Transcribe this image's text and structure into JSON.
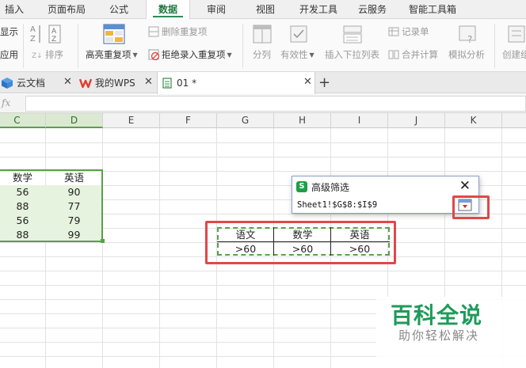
{
  "ribbon": {
    "tabs": [
      {
        "label": "插入",
        "active": false
      },
      {
        "label": "页面布局",
        "active": false
      },
      {
        "label": "公式",
        "active": false
      },
      {
        "label": "数据",
        "active": true
      },
      {
        "label": "审阅",
        "active": false
      },
      {
        "label": "视图",
        "active": false
      },
      {
        "label": "开发工具",
        "active": false
      },
      {
        "label": "云服务",
        "active": false
      },
      {
        "label": "智能工具箱",
        "active": false
      }
    ],
    "show_label": "显示",
    "apply_label": "应用",
    "sort_label": "排序",
    "highlight_dup_label": "高亮重复项",
    "delete_dup_label": "删除重复项",
    "reject_dup_label": "拒绝录入重复项",
    "split_label": "分列",
    "validity_label": "有效性",
    "insert_dropdown_label": "插入下拉列表",
    "record_label": "记录单",
    "merge_calc_label": "合并计算",
    "simulate_label": "模拟分析",
    "create_label": "创建组"
  },
  "doc_tabs": {
    "cloud_docs": "云文档",
    "my_wps": "我的WPS",
    "active_file": "01 *",
    "add": "+"
  },
  "formula_bar": {
    "fx": "fx",
    "value": ""
  },
  "sheet": {
    "columns": [
      "C",
      "D",
      "E",
      "F",
      "G",
      "H",
      "I",
      "J",
      "K"
    ],
    "data_table": {
      "headers": [
        "数学",
        "英语"
      ],
      "rows": [
        [
          "56",
          "90"
        ],
        [
          "88",
          "77"
        ],
        [
          "56",
          "79"
        ],
        [
          "88",
          "99"
        ]
      ]
    },
    "criteria": {
      "headers": [
        "语文",
        "数学",
        "英语"
      ],
      "values": [
        ">60",
        ">60",
        ">60"
      ]
    }
  },
  "dialog": {
    "title": "高级筛选",
    "logo": "S",
    "range_value": "Sheet1!$G$8:$I$9",
    "close": "✕"
  },
  "watermark": {
    "main": "百科全说",
    "sub": "助你轻松解决"
  },
  "colors": {
    "accent_green": "#5aa04a",
    "highlight_red": "#e04848",
    "ribbon_active": "#1f7a3f"
  }
}
